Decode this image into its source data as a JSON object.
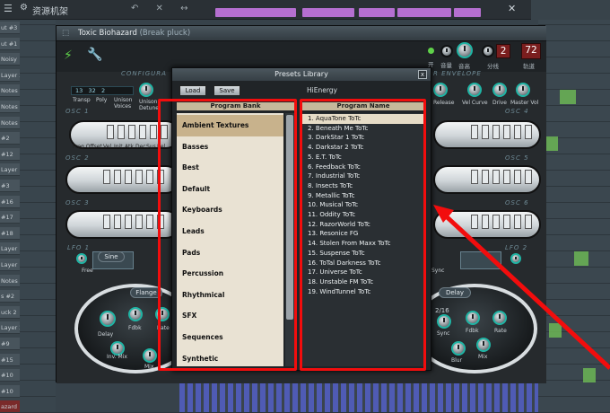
{
  "daw": {
    "title": "资源机架",
    "rack_labels": [
      "ut #3",
      "ut #1",
      "Noisy",
      "Layer 2",
      "Notes",
      "Notes 2",
      "Notes",
      "#2",
      "#12",
      "Layer",
      "#3",
      "#16",
      "#17",
      "#18",
      "Layer",
      "Layer",
      "Notes",
      "s #2",
      "uck 2",
      "Layer 2",
      "#9",
      "#15",
      "#10",
      "#10",
      "azard"
    ],
    "colors": {
      "accent_pink": "#b56fd0",
      "green": "#6fbd55",
      "bottom_blue": "#4f5bb4"
    }
  },
  "plugin": {
    "title": "Toxic Biohazard",
    "subtitle": "(Break pluck)",
    "header_labels": {
      "mix_a": "开",
      "mix_b": "音量",
      "pitch": "音高",
      "polyphony": "2",
      "poly_label": "分线",
      "pan": "72",
      "pan_label": "轨道"
    },
    "sections": {
      "config": "CONFIGURA",
      "envelope": "R ENVELOPE",
      "osc1": "OSC 1",
      "osc2": "OSC 2",
      "osc3": "OSC 3",
      "osc4": "OSC 4",
      "osc5": "OSC 5",
      "osc6": "OSC 6",
      "lfo1": "LFO 1",
      "lfo2": "LFO 2"
    },
    "config": {
      "transp": "13",
      "poly": "32",
      "unison": "2",
      "labels": [
        "Transp",
        "Poly",
        "Unison Voices",
        "Unison Detune"
      ]
    },
    "env_labels": [
      "Release",
      "Vel Curve",
      "Drive",
      "Master Vol"
    ],
    "osc_labels": [
      "Freq Offset",
      "Vel",
      "Init",
      "Atk",
      "Dec",
      "Sus",
      "Rel"
    ],
    "lfo1": {
      "shape": "Sine",
      "label": "Free"
    },
    "lfo2": {
      "label": "Sync"
    },
    "effects_left": {
      "mode": "Flange",
      "labels": [
        "Delay",
        "Fdbk",
        "Rate",
        "Inv. Mix",
        "Mix"
      ]
    },
    "effects_right": {
      "mode": "Delay",
      "value": "2/16",
      "labels": [
        "Sync",
        "Fdbk",
        "Rate",
        "Blur",
        "Mix"
      ]
    }
  },
  "dialog": {
    "title": "Presets Library",
    "close": "x",
    "load_label": "Load",
    "save_label": "Save",
    "preset_name": "HiEnergy",
    "bank_header": "Program Bank",
    "names_header": "Program Name",
    "banks": [
      "Ambient Textures",
      "Basses",
      "Best",
      "Default",
      "Keyboards",
      "Leads",
      "Pads",
      "Percussion",
      "Rhythmical",
      "SFX",
      "Sequences",
      "Synthetic"
    ],
    "selected_bank": 0,
    "programs": [
      "1. AquaTone ToTc",
      "2. Beneath Me ToTc",
      "3. DarkStar 1 ToTc",
      "4. Darkstar 2 ToTc",
      "5. E.T. ToTc",
      "6. Feedback ToTc",
      "7. Industrial ToTc",
      "8. Insects ToTc",
      "9. Metallic ToTc",
      "10. Musical ToTc",
      "11. Oddity ToTc",
      "12. RazorWorld ToTc",
      "13. Resonice FG",
      "14. Stolen From Maxx ToTc",
      "15. Suspense ToTc",
      "16. ToTal Darkness ToTc",
      "17. Universe ToTc",
      "18. Unstable FM ToTc",
      "19. WindTunnel ToTc"
    ],
    "selected_program": 0
  },
  "annotation": {
    "color": "#f20d0d"
  }
}
